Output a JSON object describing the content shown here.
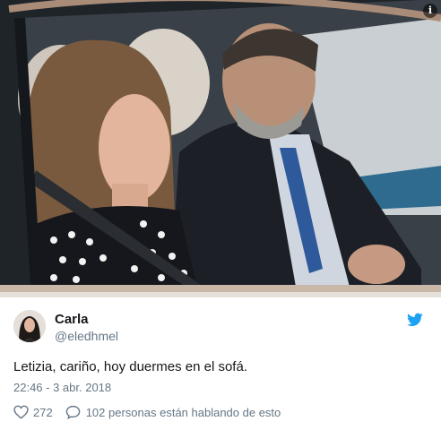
{
  "media": {
    "photo": "car-window-portrait-photo",
    "info_icon": "info-icon",
    "info_glyph": "i"
  },
  "tweet": {
    "author": {
      "name": "Carla",
      "handle": "@eledhmel",
      "avatar": "avatar-photo"
    },
    "brand_icon": "twitter-bird-icon",
    "text": "Letizia, cariño, hoy duermes en el sofá.",
    "timestamp": "22:46 - 3 abr. 2018",
    "likes": "272",
    "conversation": "102 personas están hablando de esto"
  },
  "colors": {
    "brand": "#1da1f2",
    "text_primary": "#14171a",
    "text_secondary": "#657786"
  }
}
